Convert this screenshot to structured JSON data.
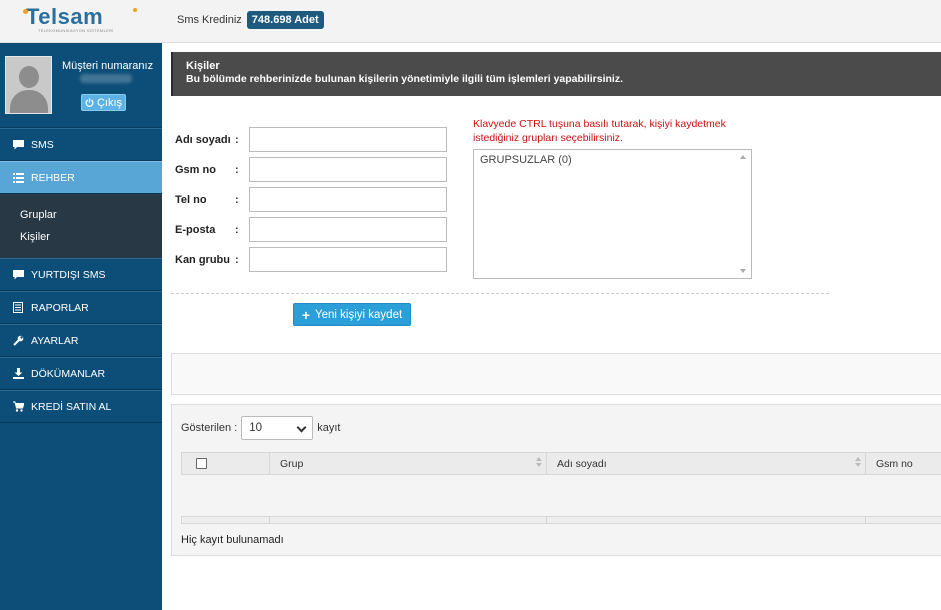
{
  "brand": {
    "name": "Telsam",
    "tagline": "TELEKOMÜNİKASYON SİSTEMLERİ"
  },
  "header": {
    "credit_label": "Sms Krediniz",
    "credit_value": "748.698 Adet"
  },
  "profile": {
    "label": "Müşteri numaranız",
    "logout": "Çıkış"
  },
  "sidebar": {
    "items": [
      {
        "label": "SMS",
        "icon": "chat-icon"
      },
      {
        "label": "REHBER",
        "icon": "list-icon",
        "active": true
      },
      {
        "label": "YURTDIŞI SMS",
        "icon": "chat-icon"
      },
      {
        "label": "RAPORLAR",
        "icon": "report-icon"
      },
      {
        "label": "AYARLAR",
        "icon": "wrench-icon"
      },
      {
        "label": "DÖKÜMANLAR",
        "icon": "download-icon"
      },
      {
        "label": "KREDİ SATIN AL",
        "icon": "cart-icon"
      }
    ],
    "submenu": [
      "Gruplar",
      "Kişiler"
    ]
  },
  "info": {
    "title": "Kişiler",
    "text": "Bu bölümde rehberinizde bulunan kişilerin yönetimiyle ilgili tüm işlemleri yapabilirsiniz."
  },
  "form": {
    "fields": [
      {
        "label": "Adı soyadı",
        "value": ""
      },
      {
        "label": "Gsm no",
        "value": ""
      },
      {
        "label": "Tel no",
        "value": ""
      },
      {
        "label": "E-posta",
        "value": ""
      },
      {
        "label": "Kan grubu",
        "value": ""
      }
    ],
    "colon": ":",
    "group_hint": "Klavyede CTRL tuşuna basılı tutarak, kişiyi kaydetmek istediğiniz grupları seçebilirsiniz.",
    "groups": [
      "GRUPSUZLAR (0)"
    ],
    "save_button": "Yeni kişiyi kaydet"
  },
  "table": {
    "show_label": "Gösterilen :",
    "page_size": "10",
    "show_suffix": "kayıt",
    "columns": [
      "Grup",
      "Adı soyadı",
      "Gsm no"
    ],
    "empty_message": "Hiç kayıt bulunamadı"
  }
}
